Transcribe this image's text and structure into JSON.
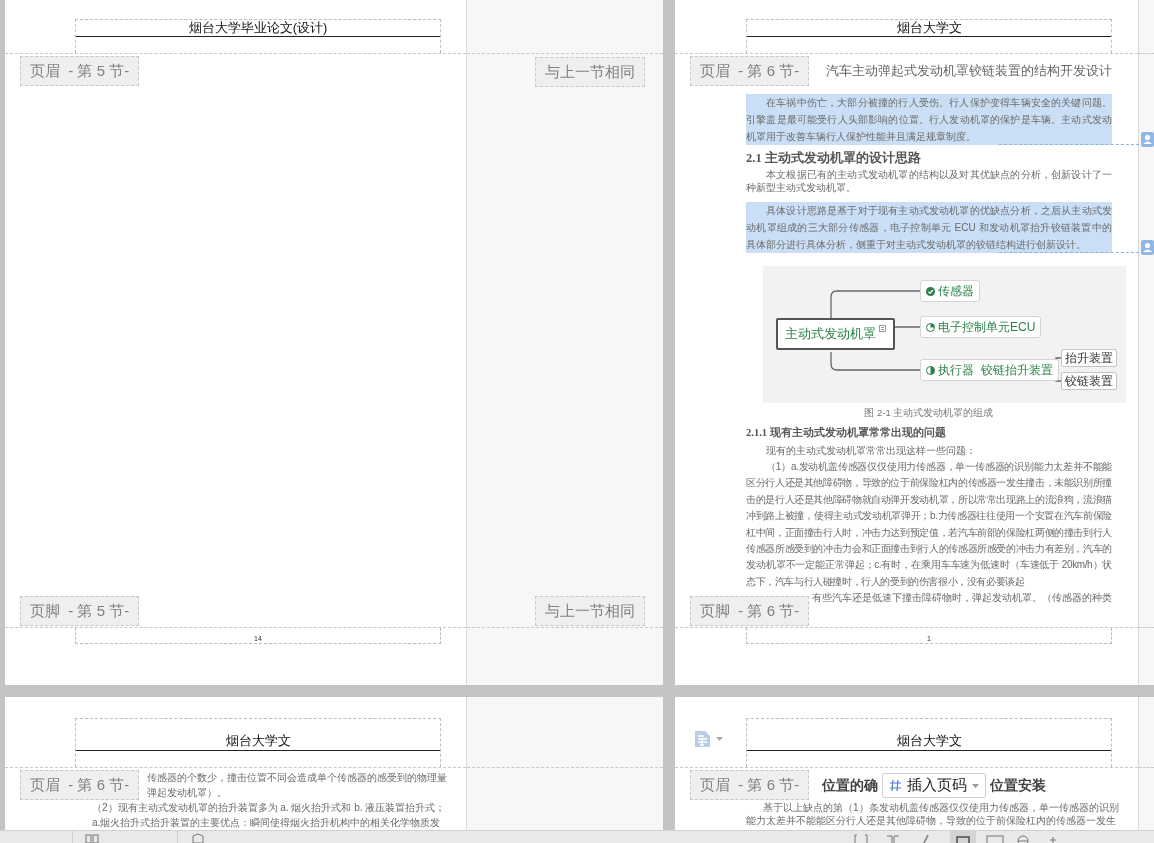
{
  "pages": [
    {
      "header": {
        "title": "烟台大学毕业论文(设计)",
        "label": "页眉  - 第 5 节-",
        "link_label": "与上一节相同"
      },
      "footer": {
        "label": "页脚  - 第 5 节-",
        "link_label": "与上一节相同",
        "page_number": "14"
      }
    },
    {
      "header": {
        "title": "烟台大学文",
        "label": "页眉  - 第 6 节-"
      },
      "blocks": [
        {
          "kind": "title",
          "text": "汽车主动弹起式发动机罩铰链装置的结构开发设计"
        },
        {
          "kind": "paragraph",
          "text": "在车祸中伤亡，大部分被撞的行人受伤。行人保护变得车辆安全的关键问题。引擎盖是最可能受行人头部影响的位置。行人发动机罩的保护是车辆。主动式发动机罩用于改善车辆行人保护性能并且满足规章制度。",
          "selected": true,
          "commented": true
        },
        {
          "kind": "heading",
          "text": "2.1 主动式发动机罩的设计思路"
        },
        {
          "kind": "paragraph",
          "text": "本文根据已有的主动式发动机罩的结构以及对其优缺点的分析，创新设计了一种新型主动式发动机罩。",
          "selected": false,
          "commented": false
        },
        {
          "kind": "paragraph",
          "text": "具体设计思路是基于对于现有主动式发动机罩的优缺点分析，之后从主动式发动机罩组成的三大部分传感器，电子控制单元 ECU 和发动机罩抬升铰链装置中的具体部分进行具体分析，侧重于对主动式发动机罩的铰链结构进行创新设计。",
          "selected": true,
          "commented": true
        },
        {
          "kind": "mindmap",
          "root": "主动式发动机罩",
          "branches": [
            {
              "text": "传感器",
              "kind": "check"
            },
            {
              "text": "电子控制单元ECU",
              "kind": "quarter"
            },
            {
              "text": "执行器  铰链抬升装置",
              "kind": "half",
              "children": [
                {
                  "text": "抬升装置"
                },
                {
                  "text": "铰链装置"
                }
              ]
            }
          ]
        },
        {
          "kind": "caption",
          "text": "图 2-1 主动式发动机罩的组成"
        },
        {
          "kind": "subheading",
          "text": "2.1.1 现有主动式发动机罩常常出现的问题"
        },
        {
          "kind": "paragraph",
          "text": "现有的主动式发动机罩常常出现这样一些问题：",
          "selected": false,
          "commented": false
        },
        {
          "kind": "paragraph",
          "text": "（1）a.发动机盖传感器仅仅使用力传感器，单一传感器的识别能力太差并不能能区分行人还是其他障碍物，导致的位于前保险杠内的传感器一发生撞击，未能识别所撞击的是行人还是其他障碍物就自动弹开发动机罩，所以常常出现路上的流浪狗，流浪猫冲到路上被撞，使得主动式发动机罩弹开；b.力传感器往往使用一个安置在汽车前保险杠中间，正面撞击行人时，冲击力达到预定值，若汽车前部的保险杠两侧的撞击到行人传感器所感受到的冲击力会和正面撞击到行人的传感器所感受的冲击力有差别，汽车的发动机罩不一定能正常弹起；c.有时，在乘用车车速为低速时（车速低于 20km/h）状态下，汽车与行人碰撞时，行人的受到的伤害很小，没有必要谈起",
          "selected": false,
          "commented": false
        },
        {
          "kind": "partial_line",
          "text": "有些汽车还是低速下撞击障碍物时，弹起发动机罩。（传感器的种类"
        }
      ],
      "footer": {
        "label": "页脚  - 第 6 节-",
        "page_number": "1"
      }
    },
    {
      "header": {
        "title": "烟台大学文",
        "label": "页眉  - 第 6 节-"
      },
      "blocks": [
        {
          "kind": "partial_line",
          "text": "传感器的个数少，撞击位置不同会造成单个传感器的感受到的物理量"
        },
        {
          "kind": "partial_line",
          "text": "弹起发动机罩）。"
        },
        {
          "kind": "line",
          "text": "（2）现有主动式发动机罩的抬升装置多为 a. 烟火抬升式和 b. 液压装置抬升式；"
        },
        {
          "kind": "line",
          "text": "a.烟火抬升式抬升装置的主要优点：瞬间使得烟火抬升机构中的相关化学物质发"
        }
      ]
    },
    {
      "header": {
        "title": "烟台大学文",
        "label": "页眉  - 第 6 节-"
      },
      "insert_button": "插入页码",
      "blocks": [
        {
          "kind": "split_heading",
          "parts": [
            "位置的确",
            "位置安装"
          ]
        },
        {
          "kind": "line",
          "text": "基于以上缺点的第（1）条发动机盖传感器仅仅使用力传感器，单一传感器的识别"
        },
        {
          "kind": "plain_line",
          "text": "能力太差并不能能区分行人还是其他障碍物，导致的位于前保险杠内的传感器一发生"
        }
      ]
    }
  ]
}
